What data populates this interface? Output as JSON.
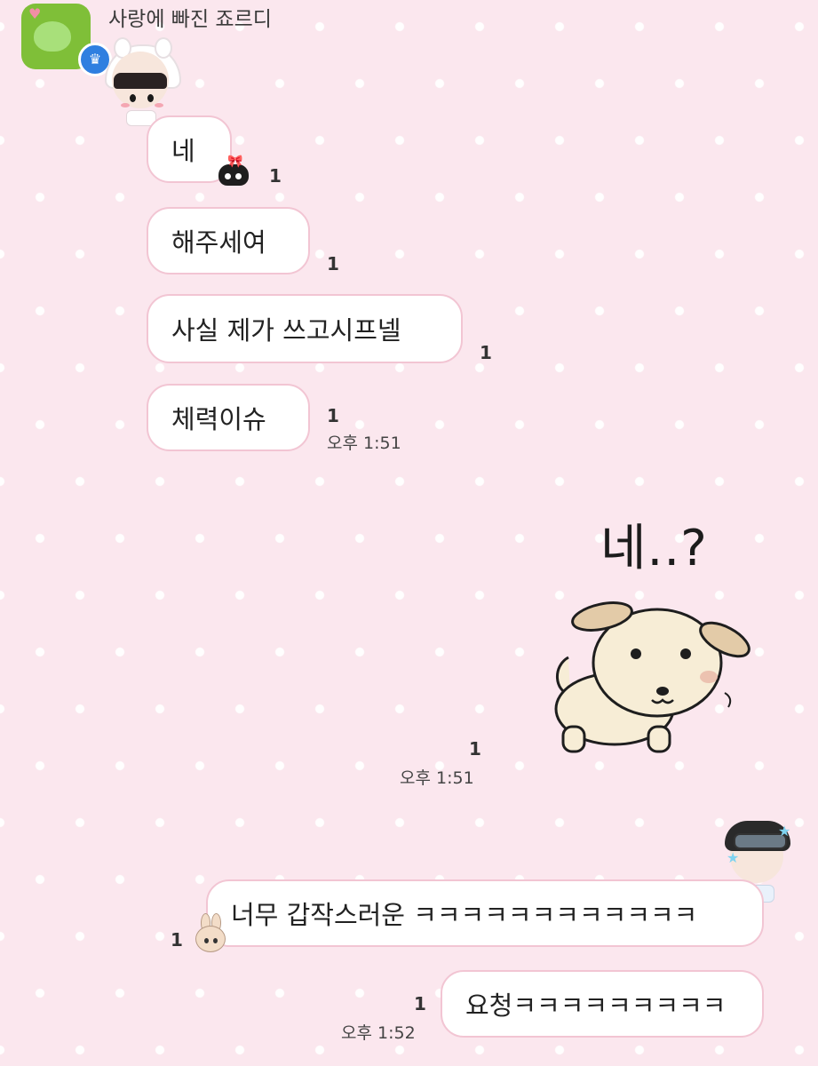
{
  "header": {
    "sender_name": "사랑에 빠진 죠르디",
    "avatar_icon": "jordy-character-icon",
    "badge_icon": "crown-icon"
  },
  "messages_left": [
    {
      "text": "네",
      "read_count": "1"
    },
    {
      "text": "해주세여",
      "read_count": "1"
    },
    {
      "text": "사실 제가 쓰고시프넬",
      "read_count": "1"
    },
    {
      "text": "체력이슈",
      "read_count": "1",
      "time": "오후 1:51"
    }
  ],
  "sticker_message": {
    "text": "네..?",
    "read_count": "1",
    "time": "오후 1:51",
    "sticker": "puppy-sticker"
  },
  "messages_right": [
    {
      "text": "너무 갑작스러운 ㅋㅋㅋㅋㅋㅋㅋㅋㅋㅋㅋㅋ",
      "read_count": "1"
    },
    {
      "text": "요청ㅋㅋㅋㅋㅋㅋㅋㅋㅋ",
      "read_count": "1",
      "time": "오후 1:52"
    }
  ],
  "colors": {
    "background": "#fbe7ee",
    "bubble": "#ffffff",
    "bubble_border": "#f2c5d3",
    "avatar": "#7fbf38",
    "crown_badge": "#2f7fe0"
  }
}
